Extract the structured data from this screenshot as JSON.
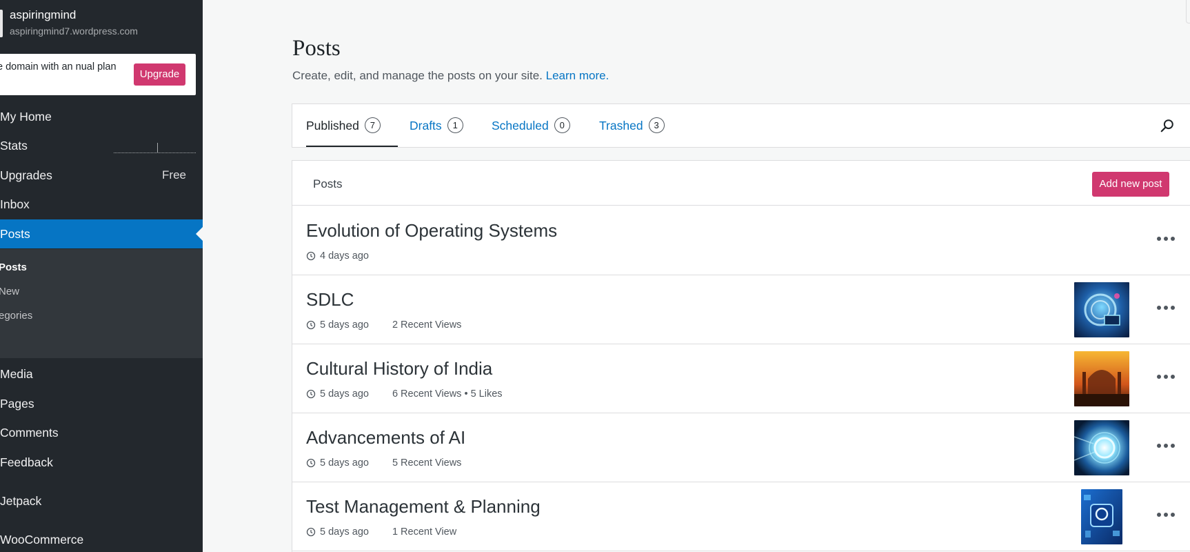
{
  "site": {
    "name": "aspiringmind",
    "url": "aspiringmind7.wordpress.com"
  },
  "upgrade_banner": {
    "text": "e domain with an nual plan",
    "button_label": "Upgrade"
  },
  "sidebar": {
    "items": [
      {
        "label": "My Home"
      },
      {
        "label": "Stats"
      },
      {
        "label": "Upgrades",
        "badge": "Free"
      },
      {
        "label": "Inbox"
      },
      {
        "label": "Posts",
        "active": true
      },
      {
        "label": "Media"
      },
      {
        "label": "Pages"
      },
      {
        "label": "Comments"
      },
      {
        "label": "Feedback"
      },
      {
        "label": "Jetpack"
      },
      {
        "label": "WooCommerce"
      }
    ],
    "submenu": [
      {
        "label": "Posts",
        "current": true
      },
      {
        "label": "New"
      },
      {
        "label": "egories"
      }
    ]
  },
  "page": {
    "title": "Posts",
    "subtitle": "Create, edit, and manage the posts on your site.",
    "learn_more": "Learn more."
  },
  "tabs": [
    {
      "label": "Published",
      "count": "7",
      "selected": true
    },
    {
      "label": "Drafts",
      "count": "1"
    },
    {
      "label": "Scheduled",
      "count": "0"
    },
    {
      "label": "Trashed",
      "count": "3"
    }
  ],
  "list": {
    "header_title": "Posts",
    "add_button": "Add new post"
  },
  "posts": [
    {
      "title": "Evolution of Operating Systems",
      "date": "4 days ago",
      "stats": "",
      "thumbnail": "none"
    },
    {
      "title": "SDLC",
      "date": "5 days ago",
      "stats": "2 Recent Views",
      "thumbnail": "blue-tech"
    },
    {
      "title": "Cultural History of India",
      "date": "5 days ago",
      "stats": "6 Recent Views • 5 Likes",
      "thumbnail": "taj-mahal"
    },
    {
      "title": "Advancements of AI",
      "date": "5 days ago",
      "stats": "5 Recent Views",
      "thumbnail": "ai-circle"
    },
    {
      "title": "Test Management & Planning",
      "date": "5 days ago",
      "stats": "1 Recent View",
      "thumbnail": "blue-icons"
    }
  ],
  "colors": {
    "sidebar_bg": "#23282d",
    "active_blue": "#0675c4",
    "accent_pink": "#d0386f"
  }
}
